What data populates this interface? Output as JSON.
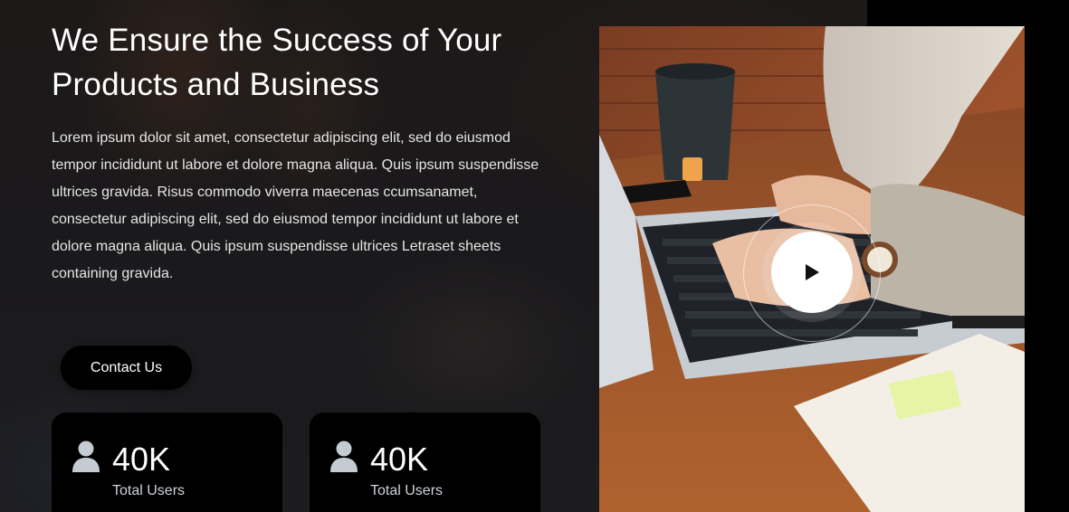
{
  "hero": {
    "title_line1": "We Ensure the Success of Your",
    "title_line2": "Products and Business",
    "description": "Lorem ipsum dolor sit amet, consectetur adipiscing elit, sed do eiusmod tempor incididunt ut labore et dolore magna aliqua. Quis ipsum suspendisse ultrices gravida. Risus commodo viverra maecenas ccumsanamet, consectetur adipiscing elit, sed do eiusmod tempor incididunt ut labore et dolore magna aliqua. Quis ipsum suspendisse ultrices Letraset sheets containing gravida.",
    "cta_label": "Contact Us"
  },
  "stats": [
    {
      "icon": "user-icon",
      "value": "40K",
      "label": "Total Users"
    },
    {
      "icon": "user-icon",
      "value": "40K",
      "label": "Total Users"
    }
  ],
  "video": {
    "icon": "play-icon"
  },
  "colors": {
    "button_bg": "#000000",
    "card_bg": "#000000",
    "text_primary": "#ffffff",
    "icon_gray": "#c5cbd3"
  }
}
